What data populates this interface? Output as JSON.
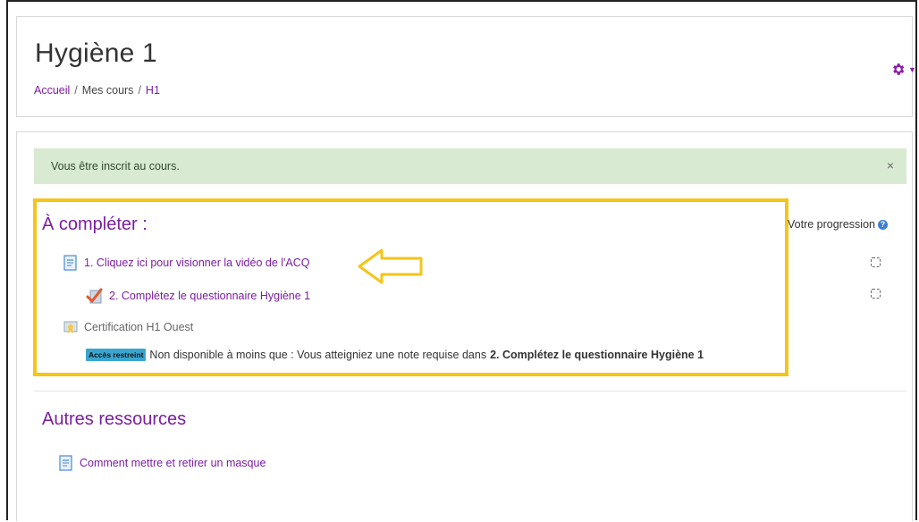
{
  "header": {
    "title": "Hygiène 1",
    "breadcrumb": [
      "Accueil",
      "Mes cours",
      "H1"
    ]
  },
  "alert": {
    "message": "Vous être inscrit au cours.",
    "close": "×"
  },
  "sections": [
    {
      "title": "À compléter :",
      "activities": [
        {
          "label": "1. Cliquez ici pour visionner la vidéo de l'ACQ",
          "icon": "page-icon"
        },
        {
          "label": "2. Complétez le questionnaire Hygiène 1",
          "icon": "quiz-icon"
        },
        {
          "label": "Certification H1 Ouest",
          "icon": "certificate-icon"
        }
      ],
      "restriction": {
        "badge": "Accès restreint",
        "text": "Non disponible à moins que : Vous atteigniez une note requise dans",
        "target": "2. Complétez le questionnaire Hygiène 1"
      }
    },
    {
      "title": "Autres ressources",
      "activities": [
        {
          "label": "Comment mettre et retirer un masque",
          "icon": "page-icon"
        }
      ]
    }
  ],
  "progress": {
    "label": "Votre progression",
    "help": "?"
  },
  "colors": {
    "accent": "#7a1ea1",
    "highlight": "#f5c518",
    "alert_bg": "#d9ead3"
  }
}
